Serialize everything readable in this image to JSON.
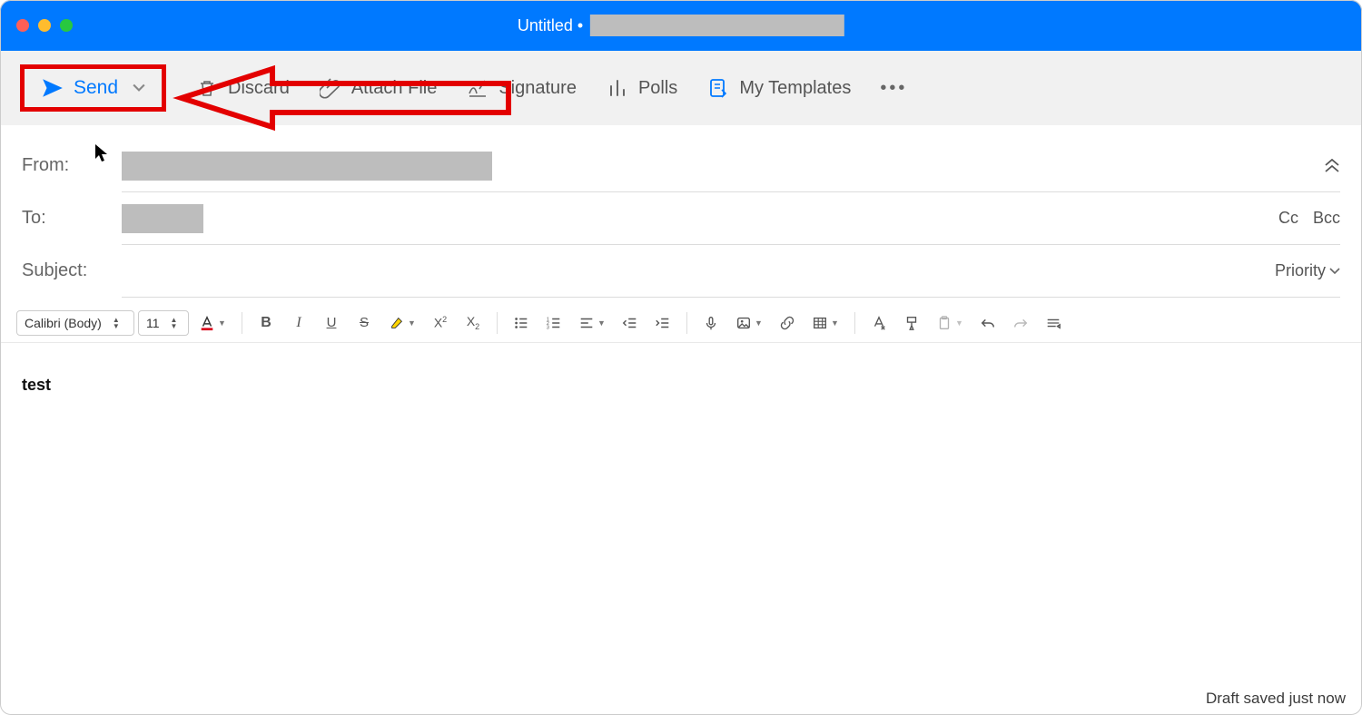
{
  "window": {
    "title": "Untitled •"
  },
  "toolbar": {
    "send": "Send",
    "discard": "Discard",
    "attach": "Attach File",
    "signature": "Signature",
    "polls": "Polls",
    "templates": "My Templates"
  },
  "fields": {
    "from_label": "From:",
    "to_label": "To:",
    "subject_label": "Subject:",
    "cc": "Cc",
    "bcc": "Bcc",
    "priority": "Priority"
  },
  "format": {
    "font": "Calibri (Body)",
    "size": "11"
  },
  "body": {
    "text": "test"
  },
  "status": {
    "draft": "Draft saved just now"
  }
}
